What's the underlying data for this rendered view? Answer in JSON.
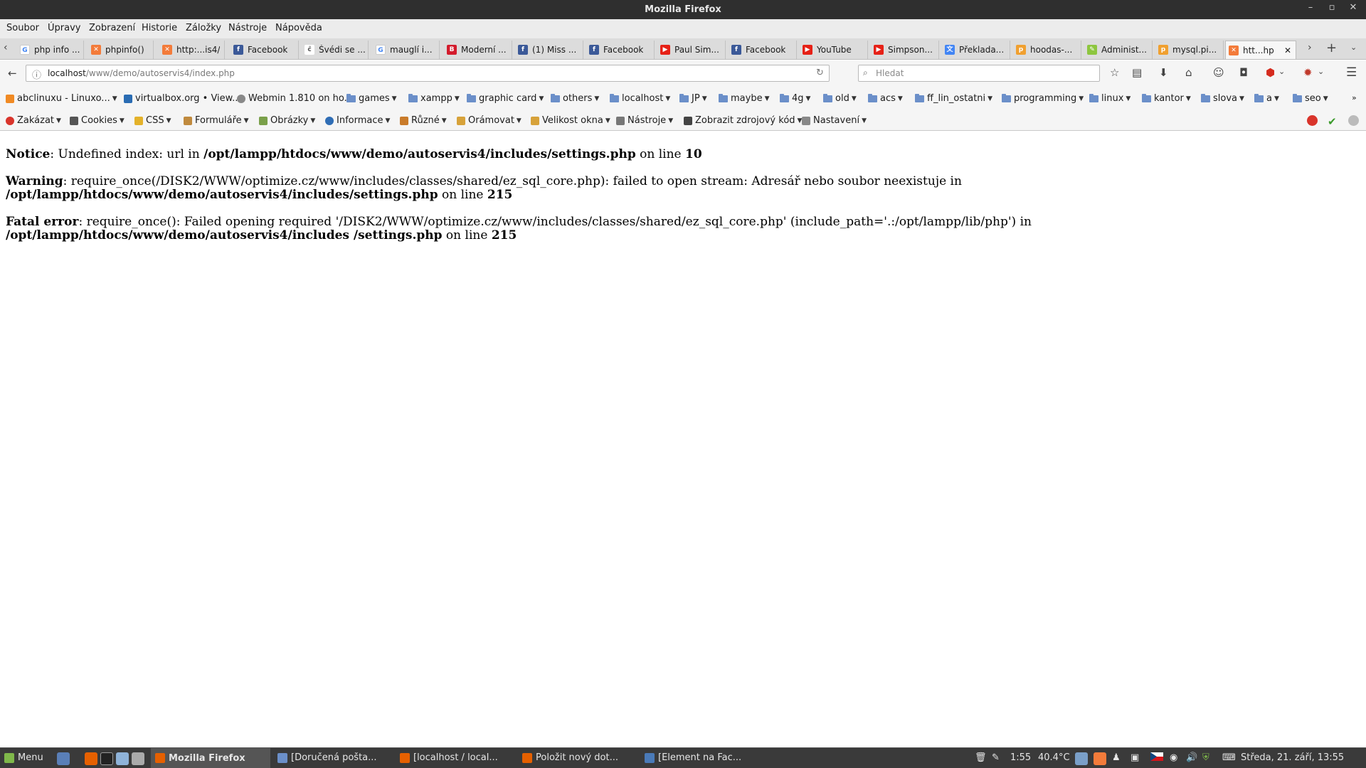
{
  "window": {
    "title": "Mozilla Firefox"
  },
  "menubar": [
    "Soubor",
    "Úpravy",
    "Zobrazení",
    "Historie",
    "Záložky",
    "Nástroje",
    "Nápověda"
  ],
  "tabs": [
    {
      "label": "php info ..."
    },
    {
      "label": "phpinfo()"
    },
    {
      "label": "http:...is4/"
    },
    {
      "label": "Facebook"
    },
    {
      "label": "Švédi se ..."
    },
    {
      "label": "mauglí i..."
    },
    {
      "label": "Moderní ..."
    },
    {
      "label": "(1) Miss ..."
    },
    {
      "label": "Facebook"
    },
    {
      "label": "Paul Sim..."
    },
    {
      "label": "Facebook"
    },
    {
      "label": "YouTube"
    },
    {
      "label": "Simpson..."
    },
    {
      "label": "Překlada..."
    },
    {
      "label": "hoodas-..."
    },
    {
      "label": "Administ..."
    },
    {
      "label": "mysql.pi..."
    },
    {
      "label": "htt...hp"
    }
  ],
  "addressbar": {
    "host": "localhost",
    "path": "/www/demo/autoservis4/index.php"
  },
  "search": {
    "placeholder": "Hledat"
  },
  "bookmarks": [
    {
      "label": "abclinuxu - Linuxo..."
    },
    {
      "label": "virtualbox.org • View..."
    },
    {
      "label": "Webmin 1.810 on ho..."
    },
    {
      "label": "games"
    },
    {
      "label": "xampp"
    },
    {
      "label": "graphic card"
    },
    {
      "label": "others"
    },
    {
      "label": "localhost"
    },
    {
      "label": "JP"
    },
    {
      "label": "maybe"
    },
    {
      "label": "4g"
    },
    {
      "label": "old"
    },
    {
      "label": "acs"
    },
    {
      "label": "ff_lin_ostatni"
    },
    {
      "label": "programming"
    },
    {
      "label": "linux"
    },
    {
      "label": "kantor"
    },
    {
      "label": "slova"
    },
    {
      "label": "a"
    },
    {
      "label": "seo"
    }
  ],
  "devtoolbar": [
    "Zakázat",
    "Cookies",
    "CSS",
    "Formuláře",
    "Obrázky",
    "Informace",
    "Různé",
    "Orámovat",
    "Velikost okna",
    "Nástroje",
    "Zobrazit zdrojový kód",
    "Nastavení"
  ],
  "errors": [
    {
      "label": "Notice",
      "text": ": Undefined index: url in ",
      "file": "/opt/lampp/htdocs/www/demo/autoservis4/includes/settings.php",
      "mid": " on line ",
      "line": "10"
    },
    {
      "label": "Warning",
      "text": ": require_once(/DISK2/WWW/optimize.cz/www/includes/classes/shared/ez_sql_core.php): failed to open stream: Adresář nebo soubor neexistuje in ",
      "file": "/opt/lampp/htdocs/www/demo/autoservis4/includes/settings.php",
      "mid": " on line ",
      "line": "215"
    },
    {
      "label": "Fatal error",
      "text": ": require_once(): Failed opening required '/DISK2/WWW/optimize.cz/www/includes/classes/shared/ez_sql_core.php' (include_path='.:/opt/lampp/lib/php') in ",
      "file": "/opt/lampp/htdocs/www/demo/autoservis4/includes /settings.php",
      "mid": " on line ",
      "line": "215"
    }
  ],
  "taskbar": {
    "menu_label": "Menu",
    "windows": [
      {
        "label": "Mozilla Firefox"
      },
      {
        "label": "[Doručená pošta..."
      },
      {
        "label": "[localhost / local..."
      },
      {
        "label": "Položit nový dot..."
      },
      {
        "label": "[Element na Fac..."
      }
    ],
    "time": "1:55",
    "temperature": "40.4°C",
    "datetime": "Středa, 21. září, 13:55"
  },
  "colors": {
    "titlebar": "#2f2f2f",
    "chrome": "#f5f5f5",
    "taskbar": "#3a3a3a",
    "facebook": "#3b5998",
    "youtube": "#e62117"
  }
}
